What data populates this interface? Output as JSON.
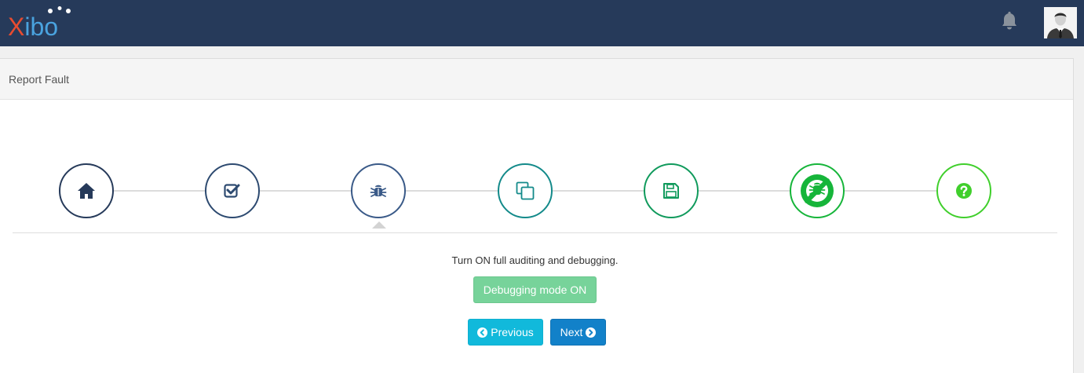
{
  "app": {
    "logo_letter_x": "X",
    "logo_letters_rest": "ibo",
    "icons": {
      "notifications": "bell-icon",
      "user": "user-avatar"
    },
    "colors": {
      "navbar": "#263a5a",
      "logo_x": "#e84c30",
      "logo_rest": "#4aa3df"
    }
  },
  "panel": {
    "title": "Report Fault"
  },
  "wizard": {
    "steps": [
      {
        "icon": "home-icon",
        "color": "#263a5a"
      },
      {
        "icon": "check-square-icon",
        "color": "#2d4a70"
      },
      {
        "icon": "bug-icon",
        "color": "#3a5a88",
        "active": true
      },
      {
        "icon": "copy-icon",
        "color": "#138a8a"
      },
      {
        "icon": "save-icon",
        "color": "#109a5c"
      },
      {
        "icon": "no-bug-icon",
        "color": "#16b53a"
      },
      {
        "icon": "question-circle-icon",
        "color": "#40cf2c"
      }
    ],
    "description": "Turn ON full auditing and debugging.",
    "debug_button_label": "Debugging mode ON",
    "previous_label": "Previous",
    "next_label": "Next"
  }
}
